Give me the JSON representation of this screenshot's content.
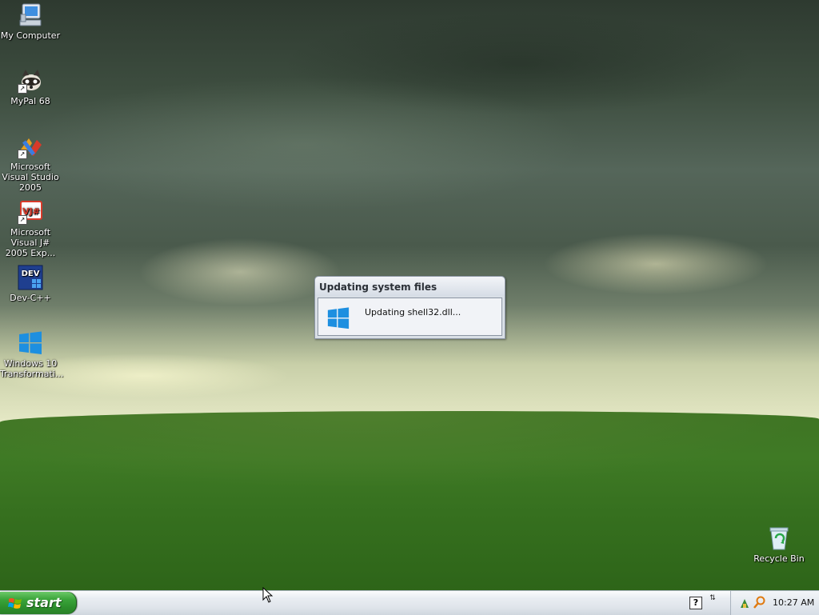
{
  "desktop": {
    "icons": [
      {
        "label": "My Computer",
        "icon": "computer-icon"
      },
      {
        "label": "MyPal 68",
        "icon": "raccoon-browser-icon"
      },
      {
        "label": "Microsoft Visual Studio 2005",
        "icon": "visual-studio-icon"
      },
      {
        "label": "Microsoft Visual J# 2005 Exp...",
        "icon": "visual-jsharp-icon"
      },
      {
        "label": "Dev-C++",
        "icon": "devcpp-icon"
      },
      {
        "label": "Windows 10 Transformati...",
        "icon": "windows-logo-icon"
      },
      {
        "label": "Recycle Bin",
        "icon": "recycle-bin-icon"
      }
    ]
  },
  "dialog": {
    "title": "Updating system files",
    "message": "Updating shell32.dll...",
    "icon": "windows-logo-icon"
  },
  "taskbar": {
    "start_label": "start",
    "help_glyph": "?",
    "arrows_glyph": "⇅",
    "clock": "10:27 AM"
  },
  "colors": {
    "start_green": "#3aa43a",
    "win_blue": "#1d8fe0",
    "taskbar_bg": "#e3e8ee"
  }
}
